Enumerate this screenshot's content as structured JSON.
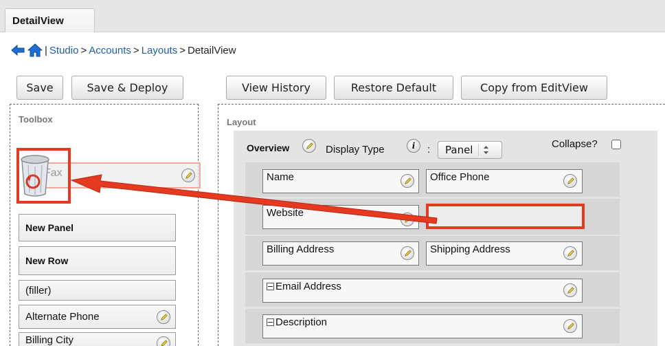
{
  "tabs": [
    {
      "label": "DetailView",
      "active": true
    }
  ],
  "breadcrumb": {
    "separator_home": "|",
    "items": [
      "Studio",
      "Accounts",
      "Layouts"
    ],
    "sep": ">",
    "current": "DetailView"
  },
  "toolbar_left": {
    "save": "Save",
    "save_deploy": "Save & Deploy"
  },
  "toolbar_right": {
    "view_history": "View History",
    "restore_default": "Restore Default",
    "copy_from_editview": "Copy from EditView"
  },
  "toolbox": {
    "title": "Toolbox",
    "drag_field": "Fax",
    "items": [
      {
        "label": "New Panel",
        "bold": true
      },
      {
        "label": "New Row",
        "bold": true
      },
      {
        "label": "(filler)",
        "bold": false
      },
      {
        "label": "Alternate Phone",
        "bold": false
      },
      {
        "label": "Billing City",
        "bold": false
      }
    ]
  },
  "layout": {
    "title": "Layout",
    "panel": {
      "name": "Overview",
      "display_type_label": "Display Type",
      "colon": ":",
      "display_type_value": "Panel",
      "collapse_label": "Collapse?",
      "collapse_checked": false
    },
    "rows": [
      [
        "Name",
        "Office Phone"
      ],
      [
        "Website",
        ""
      ],
      [
        "Billing Address",
        "Shipping Address"
      ],
      [
        "Email Address"
      ],
      [
        "Description"
      ]
    ]
  },
  "colors": {
    "highlight": "#e53a1f",
    "link": "#1f5fa8"
  }
}
